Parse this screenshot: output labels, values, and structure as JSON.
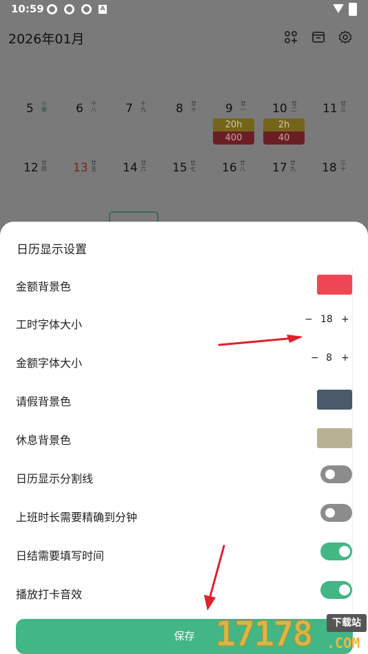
{
  "statusbar": {
    "time": "10:59",
    "notif_letter": "A"
  },
  "header": {
    "title": "2026年01月",
    "icons": [
      "apps-add-icon",
      "card-icon",
      "gear-icon"
    ]
  },
  "calendar": {
    "week1": [
      {
        "num": "5",
        "lunar": "小寒",
        "lunar_color": "green"
      },
      {
        "num": "6",
        "lunar": "十八"
      },
      {
        "num": "7",
        "lunar": "十九"
      },
      {
        "num": "8",
        "lunar": "廿十"
      },
      {
        "num": "9",
        "lunar": "廿一"
      },
      {
        "num": "10",
        "lunar": "廿二"
      },
      {
        "num": "11",
        "lunar": "廿三"
      }
    ],
    "week2": [
      {
        "num": "12",
        "lunar": "廿四"
      },
      {
        "num": "13",
        "lunar": "廿五",
        "color": "red"
      },
      {
        "num": "14",
        "lunar": "廿六"
      },
      {
        "num": "15",
        "lunar": "廿七"
      },
      {
        "num": "16",
        "lunar": "廿八"
      },
      {
        "num": "17",
        "lunar": "廿九"
      },
      {
        "num": "18",
        "lunar": "三十"
      }
    ],
    "pills": [
      {
        "hours": "20h",
        "amount": "400"
      },
      {
        "hours": "2h",
        "amount": "40"
      }
    ]
  },
  "sheet": {
    "title": "日历显示设置",
    "rows": {
      "amount_bg": {
        "label": "金额背景色",
        "color": "#ef4656"
      },
      "hours_font": {
        "label": "工时字体大小",
        "value": "18",
        "minus": "−",
        "plus": "+"
      },
      "amount_font": {
        "label": "金额字体大小",
        "value": "8",
        "minus": "−",
        "plus": "+"
      },
      "leave_bg": {
        "label": "请假背景色",
        "color": "#4a5a68"
      },
      "rest_bg": {
        "label": "休息背景色",
        "color": "#b9b193"
      },
      "divider_line": {
        "label": "日历显示分割线",
        "state": "off"
      },
      "minute_precision": {
        "label": "上班时长需要精确到分钟",
        "state": "off"
      },
      "daily_time": {
        "label": "日结需要填写时间",
        "state": "on"
      },
      "punch_sound": {
        "label": "播放打卡音效",
        "state": "on"
      }
    },
    "save_label": "保存"
  },
  "watermark": {
    "number": "17178",
    "tag": "下载站",
    "suffix": ".COM"
  },
  "colors": {
    "accent": "#43b686",
    "annotation": "#e0202a"
  }
}
